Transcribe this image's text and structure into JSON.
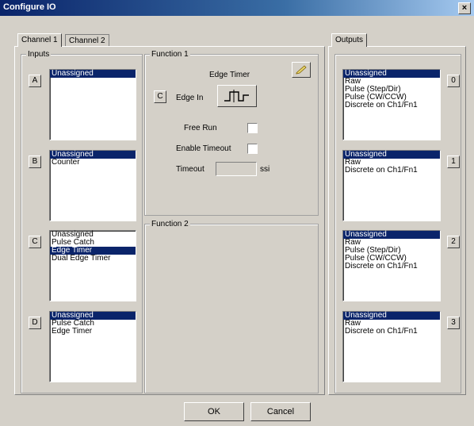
{
  "window": {
    "title": "Configure IO",
    "close_glyph": "×"
  },
  "tabs": {
    "channel1": "Channel 1",
    "channel2": "Channel 2",
    "outputs": "Outputs"
  },
  "inputs": {
    "label": "Inputs",
    "groups": [
      {
        "letter": "A",
        "items": [
          "Unassigned"
        ],
        "selected": 0
      },
      {
        "letter": "B",
        "items": [
          "Unassigned",
          "Counter"
        ],
        "selected": 0
      },
      {
        "letter": "C",
        "items": [
          "Unassigned",
          "Pulse Catch",
          "Edge Timer",
          "Dual Edge Timer"
        ],
        "selected": 2
      },
      {
        "letter": "D",
        "items": [
          "Unassigned",
          "Pulse Catch",
          "Edge Timer"
        ],
        "selected": 0
      }
    ]
  },
  "function1": {
    "label": "Function 1",
    "name": "Edge Timer",
    "input_letter": "C",
    "edge_in_label": "Edge In",
    "free_run_label": "Free Run",
    "enable_timeout_label": "Enable Timeout",
    "timeout_label": "Timeout",
    "timeout_unit": "ssi"
  },
  "function2": {
    "label": "Function 2"
  },
  "outputs": {
    "groups": [
      {
        "number": "0",
        "items": [
          "Unassigned",
          "Raw",
          "Pulse (Step/Dir)",
          "Pulse (CW/CCW)",
          "Discrete on Ch1/Fn1"
        ],
        "selected": 0
      },
      {
        "number": "1",
        "items": [
          "Unassigned",
          "Raw",
          "Discrete on Ch1/Fn1"
        ],
        "selected": 0
      },
      {
        "number": "2",
        "items": [
          "Unassigned",
          "Raw",
          "Pulse (Step/Dir)",
          "Pulse (CW/CCW)",
          "Discrete on Ch1/Fn1"
        ],
        "selected": 0
      },
      {
        "number": "3",
        "items": [
          "Unassigned",
          "Raw",
          "Discrete on Ch1/Fn1"
        ],
        "selected": 0
      }
    ]
  },
  "buttons": {
    "ok": "OK",
    "cancel": "Cancel"
  },
  "icons": {
    "pencil": "pencil-icon",
    "edge_waveform": "pulse-waveform-icon"
  }
}
